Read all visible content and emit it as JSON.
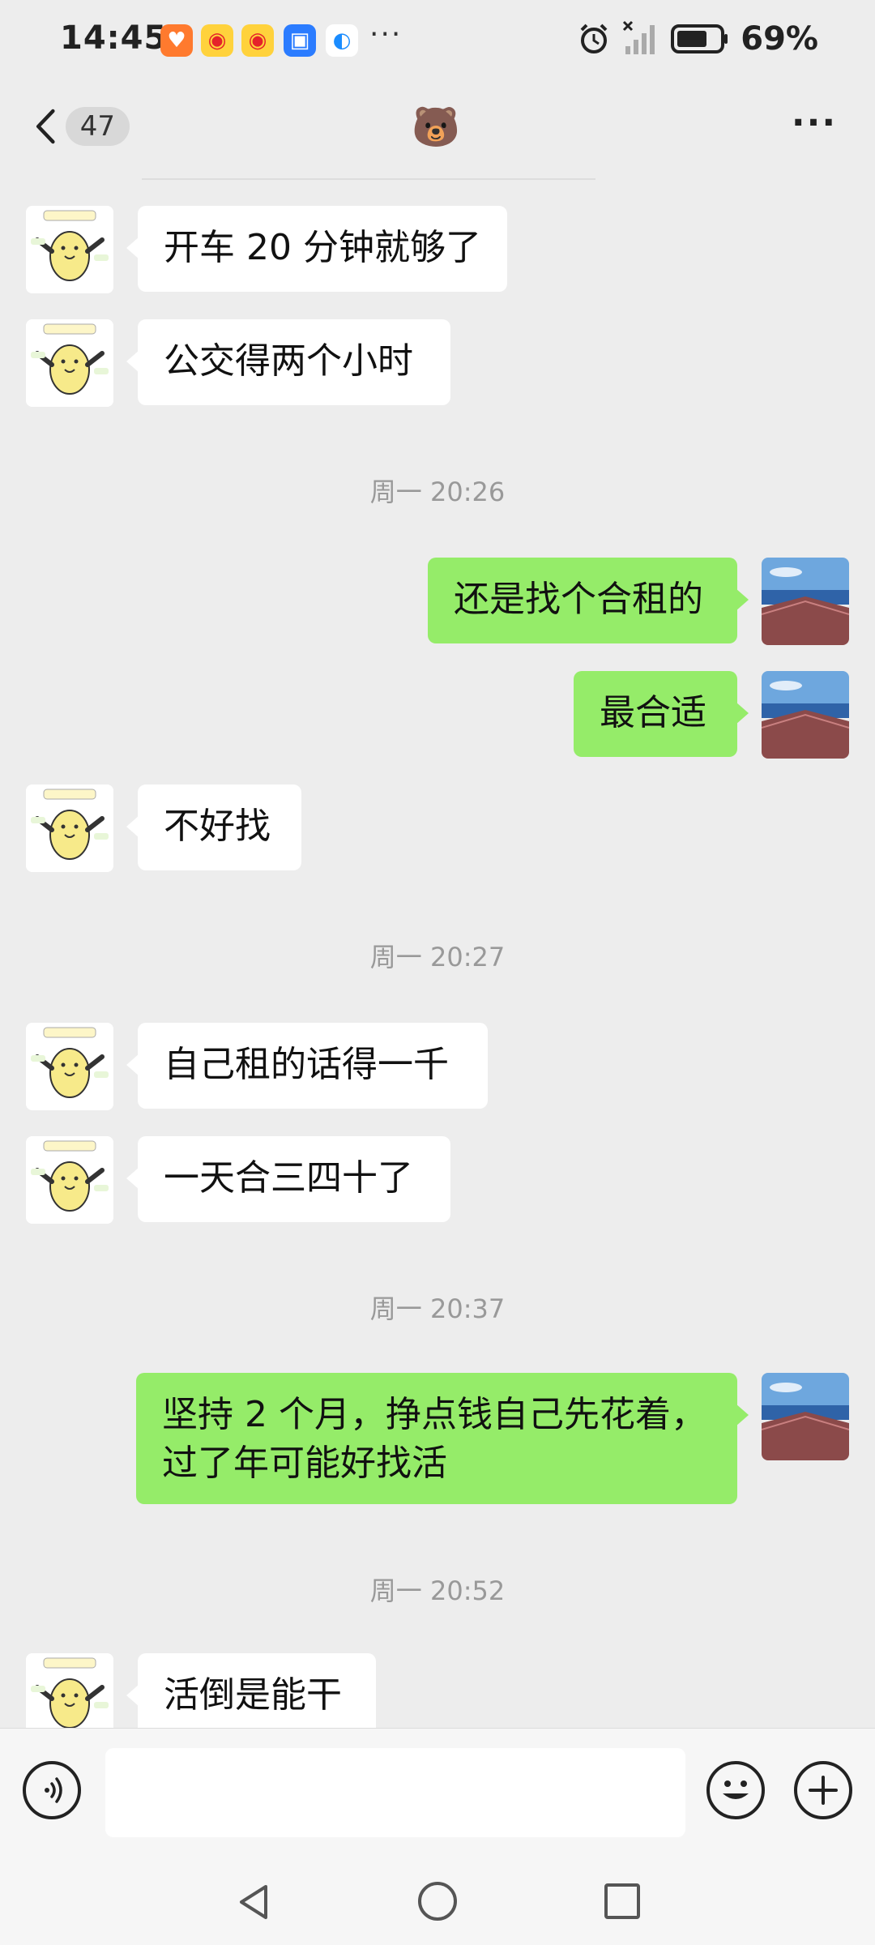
{
  "status_bar": {
    "time": "14:45",
    "battery": "69%",
    "app_icons": [
      "taobao-icon",
      "weibo-icon",
      "weibo-icon",
      "appgallery-icon",
      "browser-icon"
    ],
    "more": "···"
  },
  "header": {
    "unread_count": "47",
    "title_emoji": "🐻",
    "more": "···"
  },
  "messages": [
    {
      "side": "left",
      "text": "开车 20 分钟就够了"
    },
    {
      "side": "left",
      "text": "公交得两个小时"
    },
    {
      "timestamp": "周一 20:26"
    },
    {
      "side": "right",
      "text": "还是找个合租的"
    },
    {
      "side": "right",
      "text": "最合适"
    },
    {
      "side": "left",
      "text": "不好找"
    },
    {
      "timestamp": "周一 20:27"
    },
    {
      "side": "left",
      "text": "自己租的话得一千"
    },
    {
      "side": "left",
      "text": "一天合三四十了"
    },
    {
      "timestamp": "周一 20:37"
    },
    {
      "side": "right",
      "text": "坚持 2 个月，挣点钱自己先花着，过了年可能好找活"
    },
    {
      "timestamp": "周一 20:52"
    },
    {
      "side": "left",
      "text": "活倒是能干"
    }
  ],
  "colors": {
    "background": "#ededed",
    "bubble_self": "#95ec69",
    "bubble_other": "#ffffff",
    "timestamp": "#999999"
  }
}
